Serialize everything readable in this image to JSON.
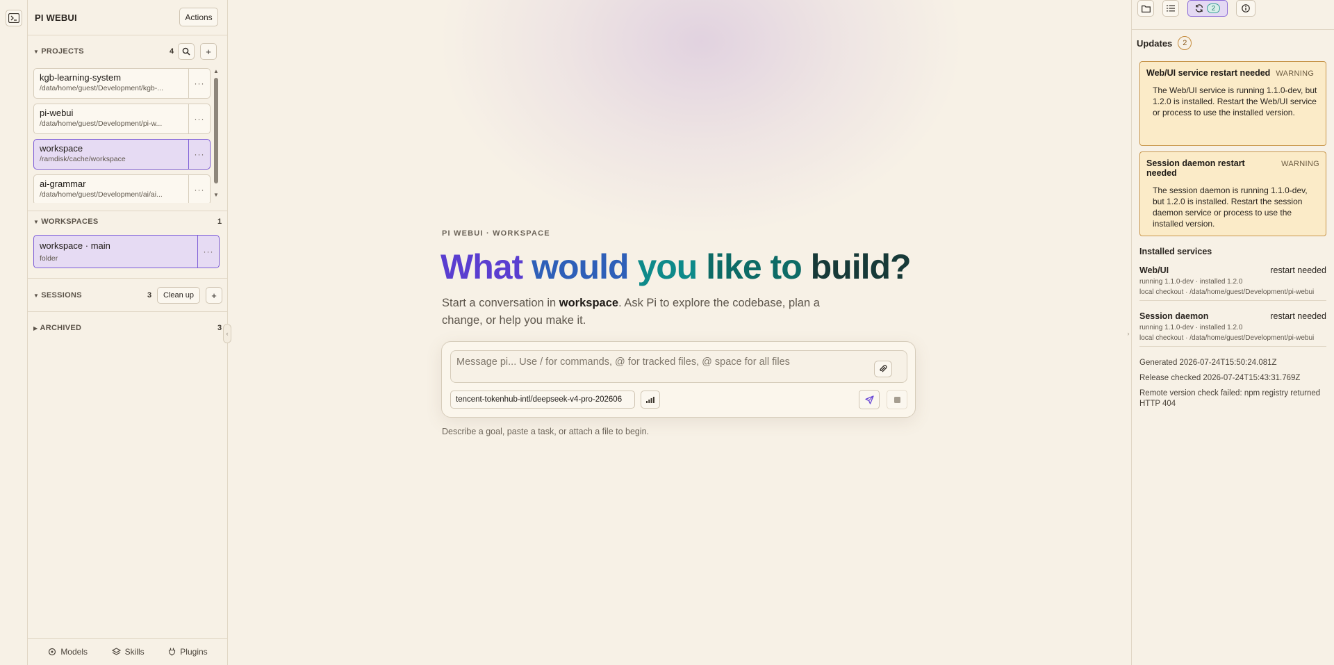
{
  "sidebar": {
    "brand": "PI WEBUI",
    "actions_label": "Actions",
    "projects": {
      "label": "PROJECTS",
      "count": "4",
      "items": [
        {
          "name": "kgb-learning-system",
          "path": "/data/home/guest/Development/kgb-..."
        },
        {
          "name": "pi-webui",
          "path": "/data/home/guest/Development/pi-w..."
        },
        {
          "name": "workspace",
          "path": "/ramdisk/cache/workspace"
        },
        {
          "name": "ai-grammar",
          "path": "/data/home/guest/Development/ai/ai..."
        }
      ]
    },
    "workspaces": {
      "label": "WORKSPACES",
      "count": "1",
      "items": [
        {
          "name": "workspace · main",
          "kind": "folder"
        }
      ]
    },
    "sessions": {
      "label": "SESSIONS",
      "count": "3",
      "cleanup_label": "Clean up"
    },
    "archived": {
      "label": "ARCHIVED",
      "count": "3"
    },
    "footer": {
      "models": "Models",
      "skills": "Skills",
      "plugins": "Plugins"
    },
    "more_glyph": "···"
  },
  "main": {
    "kicker": "PI WEBUI · WORKSPACE",
    "hero": {
      "w1": "What",
      "w2": "would",
      "w3": "you",
      "w4": "like to",
      "w5": "build?"
    },
    "subtitle": {
      "before": "Start a conversation in ",
      "bold": "workspace",
      "after": ". Ask Pi to explore the codebase, plan a change, or help you make it."
    },
    "composer": {
      "placeholder": "Message pi... Use / for commands, @ for tracked files, @ space for all files",
      "model": "tencent-tokenhub-intl/deepseek-v4-pro-202606"
    },
    "hint": "Describe a goal, paste a task, or attach a file to begin."
  },
  "right_panel": {
    "updates_badge": "2",
    "updates_title": "Updates",
    "updates_count": "2",
    "warnings": [
      {
        "title": "Web/UI service restart needed",
        "level": "WARNING",
        "body": "The Web/UI service is running 1.1.0-dev, but 1.2.0 is installed. Restart the Web/UI service or process to use the installed version."
      },
      {
        "title": "Session daemon restart needed",
        "level": "WARNING",
        "body": "The session daemon is running 1.1.0-dev, but 1.2.0 is installed. Restart the session daemon service or process to use the installed version."
      }
    ],
    "installed_title": "Installed services",
    "services": [
      {
        "name": "Web/UI",
        "status": "restart needed",
        "versions": "running 1.1.0-dev · installed 1.2.0",
        "source": "local checkout · /data/home/guest/Development/pi-webui"
      },
      {
        "name": "Session daemon",
        "status": "restart needed",
        "versions": "running 1.1.0-dev · installed 1.2.0",
        "source": "local checkout · /data/home/guest/Development/pi-webui"
      }
    ],
    "generated": "Generated 2026-07-24T15:50:24.081Z",
    "release_checked": "Release checked 2026-07-24T15:43:31.769Z",
    "remote_check": "Remote version check failed: npm registry returned HTTP 404"
  },
  "colors": {
    "accent": "#7c5cd6",
    "warning_bg": "#fbebc8",
    "warning_border": "#c7954a",
    "background": "#f7f1e6"
  },
  "icons": [
    "terminal-icon",
    "search-icon",
    "plus-icon",
    "more-icon",
    "paperclip-icon",
    "signal-icon",
    "send-icon",
    "stop-icon",
    "folder-icon",
    "list-icon",
    "refresh-icon",
    "info-icon",
    "models-icon",
    "skills-icon",
    "plugins-icon"
  ]
}
